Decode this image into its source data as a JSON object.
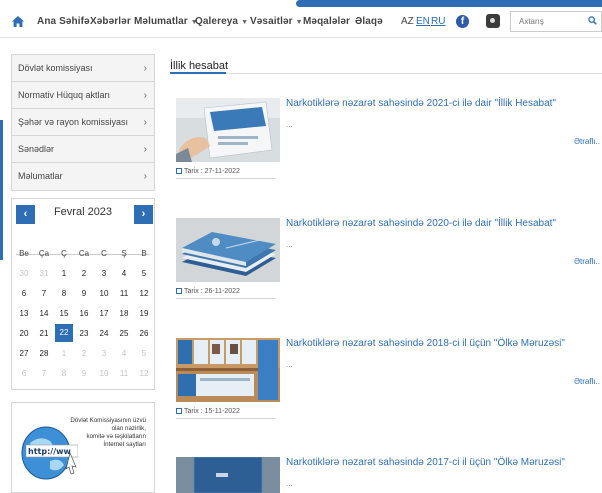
{
  "nav": {
    "items": [
      {
        "label": "Ana Səhifə",
        "dropdown": false
      },
      {
        "label": "Xəbərlər",
        "dropdown": false
      },
      {
        "label": "Məlumatlar",
        "dropdown": true
      },
      {
        "label": "Qalereya",
        "dropdown": true
      },
      {
        "label": "Vəsaitlər",
        "dropdown": true
      },
      {
        "label": "Məqalələr",
        "dropdown": false
      },
      {
        "label": "Əlaqə",
        "dropdown": false
      }
    ],
    "languages": [
      "AZ",
      "EN",
      "RU"
    ],
    "search_placeholder": "Axtarış",
    "accent_color": "#2e6eb5"
  },
  "sidebar": {
    "menu": [
      {
        "label": "Dövlət komissiyası"
      },
      {
        "label": "Normativ Hüquq aktları"
      },
      {
        "label": "Şəhər və rayon komissiyası"
      },
      {
        "label": "Sənədlər"
      },
      {
        "label": "Məlumatlar"
      }
    ],
    "calendar": {
      "title": "Fevral 2023",
      "prev": "‹",
      "next": "›",
      "weekdays": [
        "Be",
        "Ça",
        "Ç",
        "Ca",
        "C",
        "Ş",
        "B"
      ],
      "weeks": [
        [
          {
            "d": "30",
            "m": true
          },
          {
            "d": "31",
            "m": true
          },
          {
            "d": "1"
          },
          {
            "d": "2"
          },
          {
            "d": "3"
          },
          {
            "d": "4"
          },
          {
            "d": "5"
          }
        ],
        [
          {
            "d": "6"
          },
          {
            "d": "7"
          },
          {
            "d": "8"
          },
          {
            "d": "9"
          },
          {
            "d": "10"
          },
          {
            "d": "11"
          },
          {
            "d": "12"
          }
        ],
        [
          {
            "d": "13"
          },
          {
            "d": "14"
          },
          {
            "d": "15"
          },
          {
            "d": "16"
          },
          {
            "d": "17"
          },
          {
            "d": "18"
          },
          {
            "d": "19"
          }
        ],
        [
          {
            "d": "20"
          },
          {
            "d": "21"
          },
          {
            "d": "22",
            "today": true
          },
          {
            "d": "23"
          },
          {
            "d": "24"
          },
          {
            "d": "25"
          },
          {
            "d": "26"
          }
        ],
        [
          {
            "d": "27"
          },
          {
            "d": "28"
          },
          {
            "d": "1",
            "m": true
          },
          {
            "d": "2",
            "m": true
          },
          {
            "d": "3",
            "m": true
          },
          {
            "d": "4",
            "m": true
          },
          {
            "d": "5",
            "m": true
          }
        ],
        [
          {
            "d": "6",
            "m": true
          },
          {
            "d": "7",
            "m": true
          },
          {
            "d": "8",
            "m": true
          },
          {
            "d": "9",
            "m": true
          },
          {
            "d": "10",
            "m": true
          },
          {
            "d": "11",
            "m": true
          },
          {
            "d": "12",
            "m": true
          }
        ]
      ]
    },
    "banner": {
      "text_lines": [
        "Dövlət Komissiyasının üzvü",
        "olan nazirlik,",
        "komitə və təşkilatların",
        "İnternet saytları"
      ],
      "globe_text": "http://ww"
    }
  },
  "content": {
    "section_title": "İllik hesabat",
    "articles": [
      {
        "title": "Narkotiklərə nəzarət sahəsində 2021-ci ilə dair \"İllik Hesabat\"",
        "excerpt": "...",
        "date": "Tarix : 27-11-2022",
        "more": "Ətraflı..",
        "thumb": "report-hand"
      },
      {
        "title": "Narkotiklərə nəzarət sahəsində 2020-ci ilə dair \"İllik Hesabat\"",
        "excerpt": "...",
        "date": "Tarix : 26-11-2022",
        "more": "Ətraflı..",
        "thumb": "report-stack"
      },
      {
        "title": "Narkotiklərə nəzarət sahəsində 2018-ci il üçün \"Ölkə Məruzəsi\"",
        "excerpt": "...",
        "date": "Tarix : 15-11-2022",
        "more": "Ətraflı..",
        "thumb": "report-shelf"
      },
      {
        "title": "Narkotiklərə nəzarət sahəsində 2017-ci il üçün \"Ölkə Məruzəsi\"",
        "excerpt": "...",
        "date": "",
        "more": "",
        "thumb": "report-cover"
      }
    ]
  }
}
